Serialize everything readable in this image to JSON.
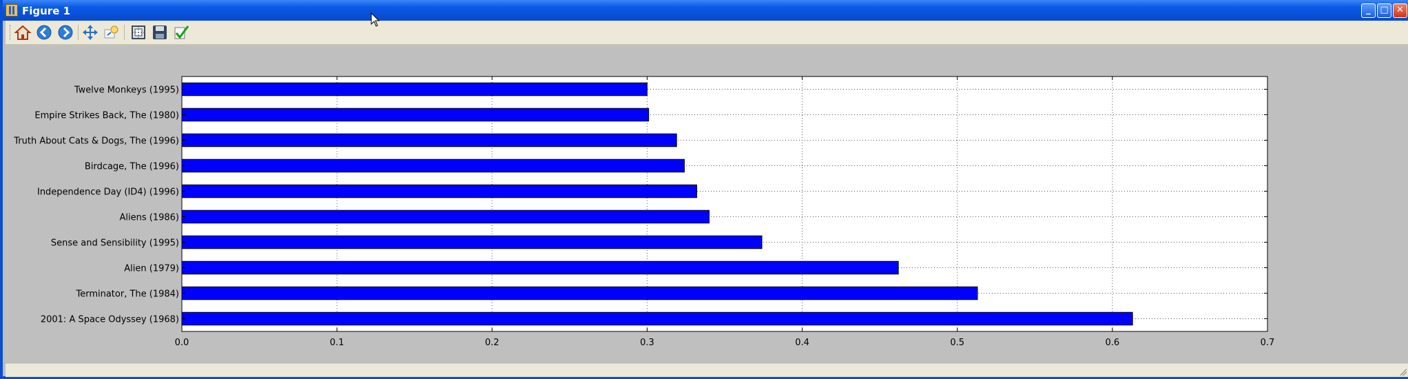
{
  "window": {
    "title": "Figure 1",
    "controls": {
      "minimize": "_",
      "maximize": "□",
      "close": "✕"
    }
  },
  "toolbar": {
    "buttons": [
      {
        "name": "home-icon",
        "tooltip": "Home"
      },
      {
        "name": "back-icon",
        "tooltip": "Back"
      },
      {
        "name": "forward-icon",
        "tooltip": "Forward"
      },
      {
        "name": "pan-icon",
        "tooltip": "Pan"
      },
      {
        "name": "zoom-icon",
        "tooltip": "Zoom"
      },
      {
        "name": "subplots-icon",
        "tooltip": "Configure subplots"
      },
      {
        "name": "save-icon",
        "tooltip": "Save"
      },
      {
        "name": "edit-check-icon",
        "tooltip": "Edit"
      }
    ]
  },
  "colors": {
    "bar": "#0000ff",
    "bar_edge": "#000000",
    "figure_bg": "#bfbfbf",
    "axes_bg": "#ffffff",
    "titlebar": "#0a5ae6"
  },
  "chart_data": {
    "type": "bar",
    "orientation": "horizontal",
    "categories": [
      "2001: A Space Odyssey (1968)",
      "Terminator, The (1984)",
      "Alien (1979)",
      "Sense and Sensibility (1995)",
      "Aliens (1986)",
      "Independence Day (ID4) (1996)",
      "Birdcage, The (1996)",
      "Truth About Cats & Dogs, The (1996)",
      "Empire Strikes Back, The (1980)",
      "Twelve Monkeys (1995)"
    ],
    "values": [
      0.613,
      0.513,
      0.462,
      0.374,
      0.34,
      0.332,
      0.324,
      0.319,
      0.301,
      0.3
    ],
    "xlim": [
      0.0,
      0.7
    ],
    "xticks": [
      "0.0",
      "0.1",
      "0.2",
      "0.3",
      "0.4",
      "0.5",
      "0.6",
      "0.7"
    ],
    "grid": true,
    "title": "",
    "xlabel": "",
    "ylabel": ""
  }
}
